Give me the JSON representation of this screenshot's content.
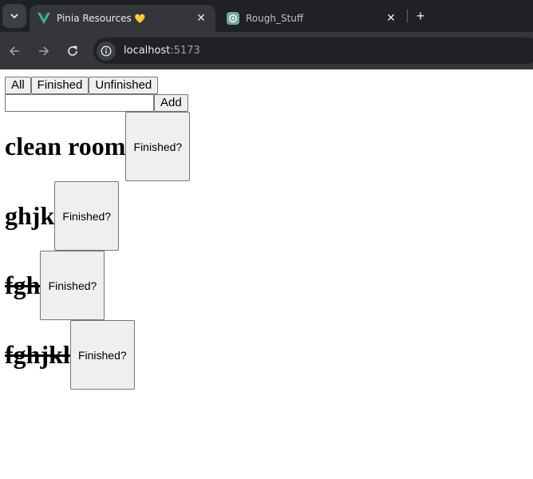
{
  "browser": {
    "tabs": [
      {
        "title": "Pinia Resources",
        "badge": "💛",
        "favicon": "vue-logo-icon",
        "active": true
      },
      {
        "title": "Rough_Stuff",
        "favicon": "chatgpt-logo-icon",
        "active": false
      }
    ],
    "close_glyph": "✕",
    "new_tab_glyph": "+",
    "address": {
      "host": "localhost",
      "port": ":5173"
    }
  },
  "app": {
    "filters": [
      "All",
      "Finished",
      "Unfinished"
    ],
    "input": {
      "value": "",
      "placeholder": ""
    },
    "add_label": "Add",
    "finish_label": "Finished?",
    "tasks": [
      {
        "title": "clean room",
        "done": false
      },
      {
        "title": "ghjk",
        "done": false
      },
      {
        "title": "fgh",
        "done": true
      },
      {
        "title": "fghjkl",
        "done": true
      }
    ]
  }
}
